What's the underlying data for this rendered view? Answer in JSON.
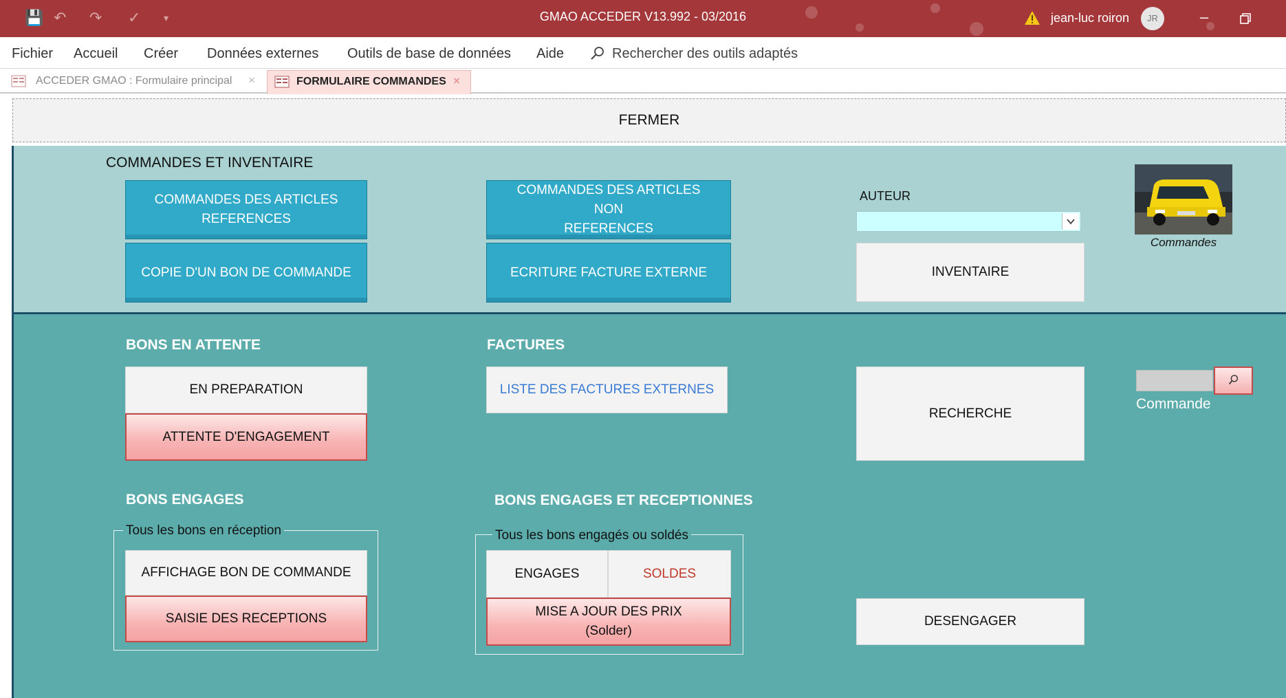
{
  "window": {
    "title": "GMAO ACCEDER V13.992 - 03/2016",
    "user_name": "jean-luc roiron",
    "user_initials": "JR",
    "accent": "#a4373a"
  },
  "menu": {
    "items": [
      "Fichier",
      "Accueil",
      "Créer",
      "Données externes",
      "Outils de base de données",
      "Aide"
    ],
    "search_text": "Rechercher des outils adaptés"
  },
  "tabs": [
    {
      "label": "ACCEDER GMAO : Formulaire principal",
      "active": false
    },
    {
      "label": "FORMULAIRE COMMANDES",
      "active": true
    }
  ],
  "form": {
    "close_label": "FERMER",
    "section1": {
      "heading": "COMMANDES ET INVENTAIRE",
      "btn_ref_l1": "COMMANDES DES ARTICLES",
      "btn_ref_l2": "REFERENCES",
      "btn_nonref_l1": "COMMANDES DES ARTICLES NON",
      "btn_nonref_l2": "REFERENCES",
      "btn_copy": "COPIE D'UN BON DE COMMANDE",
      "btn_invoice": "ECRITURE FACTURE EXTERNE",
      "author_label": "AUTEUR",
      "author_value": "",
      "btn_inventory": "INVENTAIRE",
      "image_caption": "Commandes"
    },
    "section2": {
      "pending_heading": "BONS EN ATTENTE",
      "btn_preparation": "EN PREPARATION",
      "btn_waiting": "ATTENTE D'ENGAGEMENT",
      "invoices_heading": "FACTURES",
      "btn_invoice_list": "LISTE DES FACTURES EXTERNES",
      "btn_search": "RECHERCHE",
      "order_field_label": "Commande",
      "order_field_value": "",
      "engaged_heading": "BONS ENGAGES",
      "engaged_frame_legend": "Tous les bons en réception",
      "btn_show_order": "AFFICHAGE BON DE COMMANDE",
      "btn_receptions": "SAISIE DES RECEPTIONS",
      "received_heading": "BONS ENGAGES ET RECEPTIONNES",
      "received_frame_legend": "Tous les bons engagés ou soldés",
      "btn_engaged": "ENGAGES",
      "btn_settled": "SOLDES",
      "btn_update_l1": "MISE A JOUR DES PRIX",
      "btn_update_l2": "(Solder)",
      "btn_disengage": "DESENGAGER"
    }
  }
}
